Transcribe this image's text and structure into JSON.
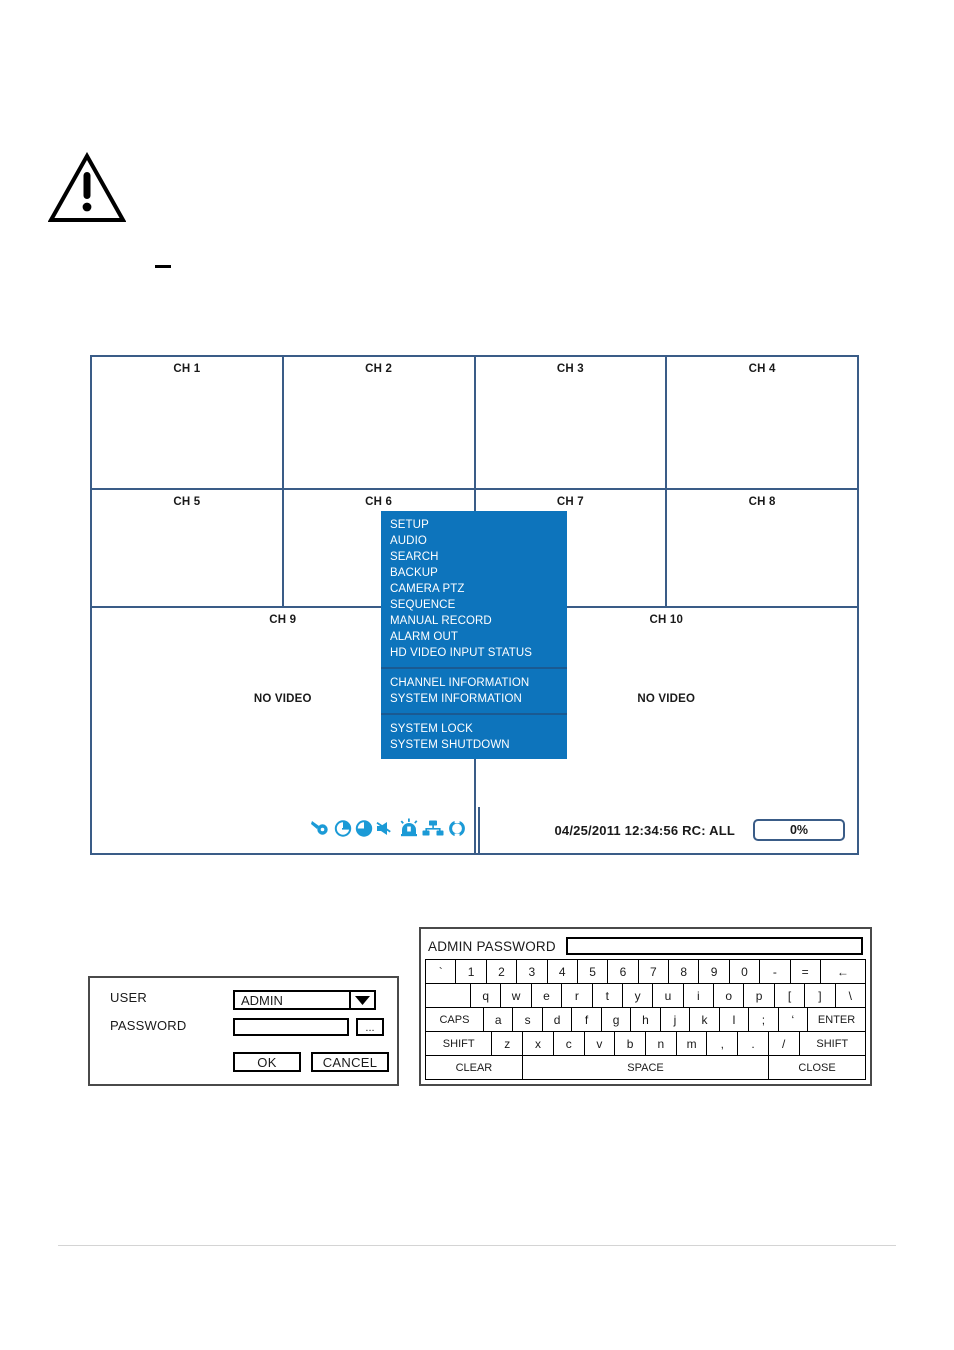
{
  "colors": {
    "menu_blue": "#0d74bc",
    "grid_border": "#3a5c87",
    "icon_blue": "#1b9ad6",
    "dialog_border": "#4a4a4a",
    "footer_rule": "#d4d4d4"
  },
  "dvr": {
    "rows": [
      {
        "cells": [
          {
            "label": "CH 1",
            "novideo": ""
          },
          {
            "label": "CH 2",
            "novideo": ""
          },
          {
            "label": "CH 3",
            "novideo": ""
          },
          {
            "label": "CH 4",
            "novideo": ""
          }
        ]
      },
      {
        "cells": [
          {
            "label": "CH 5",
            "novideo": ""
          },
          {
            "label": "CH 6",
            "novideo": ""
          },
          {
            "label": "CH 7",
            "novideo": ""
          },
          {
            "label": "CH 8",
            "novideo": ""
          }
        ]
      },
      {
        "cells": [
          {
            "label": "CH 9",
            "novideo": "NO VIDEO"
          },
          {
            "label": "CH 10",
            "novideo": "NO VIDEO"
          }
        ]
      }
    ],
    "status": {
      "icons": [
        "key-icon",
        "hdd-record-icon",
        "hdd-overwrite-icon",
        "speaker-mute-icon",
        "alarm-siren-icon",
        "network-icon",
        "sequence-refresh-icon"
      ],
      "datetime": "04/25/2011 12:34:56   RC: ALL",
      "percent": "0%"
    }
  },
  "popup_menu": {
    "groups": [
      {
        "items": [
          "SETUP",
          "AUDIO",
          "SEARCH",
          "BACKUP",
          "CAMERA PTZ",
          "SEQUENCE",
          "MANUAL RECORD",
          "ALARM OUT",
          "HD VIDEO INPUT STATUS"
        ]
      },
      {
        "items": [
          "CHANNEL INFORMATION",
          "SYSTEM INFORMATION"
        ]
      },
      {
        "items": [
          "SYSTEM LOCK",
          "SYSTEM SHUTDOWN"
        ]
      }
    ]
  },
  "login_dialog": {
    "user_label": "USER",
    "user_value": "ADMIN",
    "password_label": "PASSWORD",
    "password_value": "",
    "ellipsis_label": "...",
    "ok_label": "OK",
    "cancel_label": "CANCEL"
  },
  "virtual_keyboard": {
    "title": "ADMIN PASSWORD",
    "input_value": "",
    "rows": [
      {
        "keys": [
          {
            "label": "`",
            "w": ""
          },
          {
            "label": "1",
            "w": ""
          },
          {
            "label": "2",
            "w": ""
          },
          {
            "label": "3",
            "w": ""
          },
          {
            "label": "4",
            "w": ""
          },
          {
            "label": "5",
            "w": ""
          },
          {
            "label": "6",
            "w": ""
          },
          {
            "label": "7",
            "w": ""
          },
          {
            "label": "8",
            "w": ""
          },
          {
            "label": "9",
            "w": ""
          },
          {
            "label": "0",
            "w": ""
          },
          {
            "label": "-",
            "w": ""
          },
          {
            "label": "=",
            "w": ""
          },
          {
            "label": "←",
            "w": "w15"
          }
        ]
      },
      {
        "keys": [
          {
            "label": "",
            "w": "w15"
          },
          {
            "label": "q",
            "w": ""
          },
          {
            "label": "w",
            "w": ""
          },
          {
            "label": "e",
            "w": ""
          },
          {
            "label": "r",
            "w": ""
          },
          {
            "label": "t",
            "w": ""
          },
          {
            "label": "y",
            "w": ""
          },
          {
            "label": "u",
            "w": ""
          },
          {
            "label": "i",
            "w": ""
          },
          {
            "label": "o",
            "w": ""
          },
          {
            "label": "p",
            "w": ""
          },
          {
            "label": "[",
            "w": ""
          },
          {
            "label": "]",
            "w": ""
          },
          {
            "label": "\\",
            "w": ""
          }
        ]
      },
      {
        "keys": [
          {
            "label": "CAPS",
            "w": "w20"
          },
          {
            "label": "a",
            "w": ""
          },
          {
            "label": "s",
            "w": ""
          },
          {
            "label": "d",
            "w": ""
          },
          {
            "label": "f",
            "w": ""
          },
          {
            "label": "g",
            "w": ""
          },
          {
            "label": "h",
            "w": ""
          },
          {
            "label": "j",
            "w": ""
          },
          {
            "label": "k",
            "w": ""
          },
          {
            "label": "l",
            "w": ""
          },
          {
            "label": ";",
            "w": ""
          },
          {
            "label": "‘",
            "w": ""
          },
          {
            "label": "ENTER",
            "w": "w20"
          }
        ]
      },
      {
        "keys": [
          {
            "label": "SHIFT",
            "w": "w22"
          },
          {
            "label": "z",
            "w": ""
          },
          {
            "label": "x",
            "w": ""
          },
          {
            "label": "c",
            "w": ""
          },
          {
            "label": "v",
            "w": ""
          },
          {
            "label": "b",
            "w": ""
          },
          {
            "label": "n",
            "w": ""
          },
          {
            "label": "m",
            "w": ""
          },
          {
            "label": ",",
            "w": ""
          },
          {
            "label": ".",
            "w": ""
          },
          {
            "label": "/",
            "w": ""
          },
          {
            "label": "SHIFT",
            "w": "w22"
          }
        ]
      },
      {
        "keys": [
          {
            "label": "CLEAR",
            "w": "w25"
          },
          {
            "label": "SPACE",
            "w": "w60"
          },
          {
            "label": "CLOSE",
            "w": "w25"
          }
        ]
      }
    ]
  }
}
